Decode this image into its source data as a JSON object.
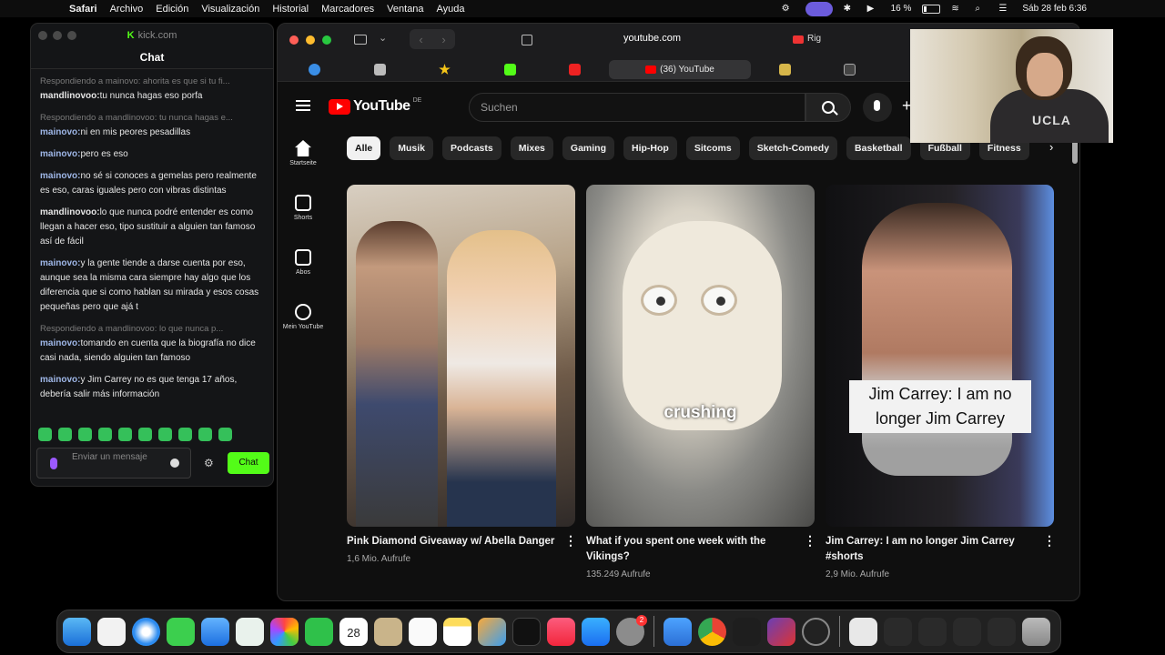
{
  "menubar": {
    "items": [
      "Safari",
      "Archivo",
      "Edición",
      "Visualización",
      "Historial",
      "Marcadores",
      "Ventana",
      "Ayuda"
    ],
    "battery": "16 %",
    "datetime": "Sáb 28 feb 6:36"
  },
  "chat_window": {
    "title": "kick.com",
    "header": "Chat",
    "messages": [
      {
        "reply": "Respondiendo a mainovo: ahorita es que si tu fi...",
        "user": "mandlinovoo:",
        "user_style": "b",
        "text": "tu nunca hagas eso porfa"
      },
      {
        "reply": "Respondiendo a mandlinovoo: tu nunca hagas e...",
        "user": "mainovo:",
        "user_style": "a",
        "text": "ni en mis peores pesadillas"
      },
      {
        "reply": "",
        "user": "mainovo:",
        "user_style": "a",
        "text": "pero es eso"
      },
      {
        "reply": "",
        "user": "mainovo:",
        "user_style": "a",
        "text": "no sé si conoces a gemelas pero realmente es eso, caras iguales pero con vibras distintas"
      },
      {
        "reply": "",
        "user": "mandlinovoo:",
        "user_style": "b",
        "text": "lo que nunca podré entender es como llegan a hacer eso, tipo sustituir a alguien tan famoso así de fácil"
      },
      {
        "reply": "",
        "user": "mainovo:",
        "user_style": "a",
        "text": "y la gente tiende a darse cuenta por eso, aunque sea la misma cara siempre hay algo que los diferencia que si como hablan su mirada y esos cosas pequeñas pero que ajá t"
      },
      {
        "reply": "Respondiendo a mandlinovoo: lo que nunca p...",
        "user": "mainovo:",
        "user_style": "a",
        "text": "tomando en cuenta que la biografía no dice casi nada, siendo alguien tan famoso"
      },
      {
        "reply": "",
        "user": "mainovo:",
        "user_style": "a",
        "text": "y Jim Carrey no es que tenga 17 años, debería salir más información"
      }
    ],
    "input_placeholder": "Enviar un mensaje",
    "send_label": "Chat"
  },
  "browser": {
    "address": "youtube.com",
    "rec_text": "Rig",
    "active_tab": "(36) YouTube"
  },
  "youtube": {
    "logo_text": "YouTube",
    "logo_region": "DE",
    "search_placeholder": "Suchen",
    "sidebar": [
      "Startseite",
      "Shorts",
      "Abos",
      "Mein YouTube"
    ],
    "chips": [
      "Alle",
      "Musik",
      "Podcasts",
      "Mixes",
      "Gaming",
      "Hip-Hop",
      "Sitcoms",
      "Sketch-Comedy",
      "Basketball",
      "Fußball",
      "Fitness"
    ],
    "videos": [
      {
        "title": "Pink Diamond Giveaway w/ Abella Danger",
        "views": "1,6 Mio. Aufrufe",
        "overlay": ""
      },
      {
        "title": "What if you spent one week with the Vikings?",
        "views": "135.249 Aufrufe",
        "overlay": "crushing"
      },
      {
        "title": "Jim Carrey: I am no longer Jim Carrey #shorts",
        "views": "2,9 Mio. Aufrufe",
        "overlay": "Jim Carrey: I am no longer Jim Carrey"
      }
    ]
  },
  "webcam": {
    "shirt_text": "UCLA"
  },
  "dock": {
    "calendar_date": "28",
    "app_store_badge": "2"
  }
}
